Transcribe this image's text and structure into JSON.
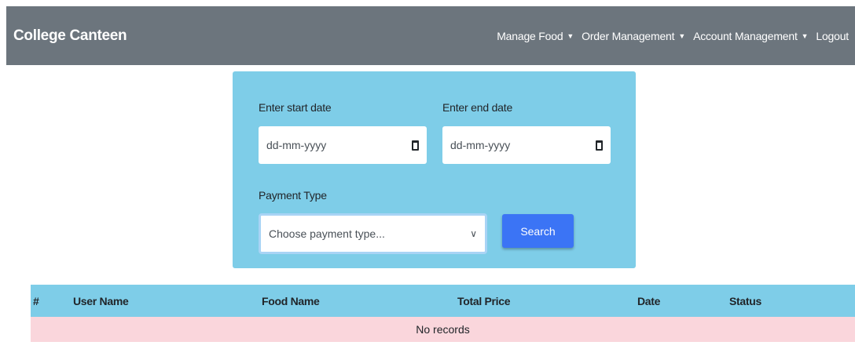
{
  "navbar": {
    "brand": "College Canteen",
    "items": [
      {
        "label": "Manage Food",
        "caret": "▼"
      },
      {
        "label": "Order Management",
        "caret": "▼"
      },
      {
        "label": "Account Management",
        "caret": "▼"
      },
      {
        "label": "Logout"
      }
    ]
  },
  "filter": {
    "start_date_label": "Enter start date",
    "start_date_placeholder": "dd-mm-yyyy",
    "end_date_label": "Enter end date",
    "end_date_placeholder": "dd-mm-yyyy",
    "payment_type_label": "Payment Type",
    "payment_type_selected": "Choose payment type...",
    "search_label": "Search"
  },
  "table": {
    "headers": [
      "#",
      "User Name",
      "Food Name",
      "Total Price",
      "Date",
      "Status"
    ],
    "empty_message": "No records"
  },
  "colors": {
    "navbar_bg": "#6c757d",
    "panel_bg": "#7ecde8",
    "button_bg": "#3b74f5",
    "empty_row_bg": "#fad6dc"
  },
  "icons": [
    "calendar-icon",
    "chevron-down-icon",
    "caret-down-icon"
  ]
}
